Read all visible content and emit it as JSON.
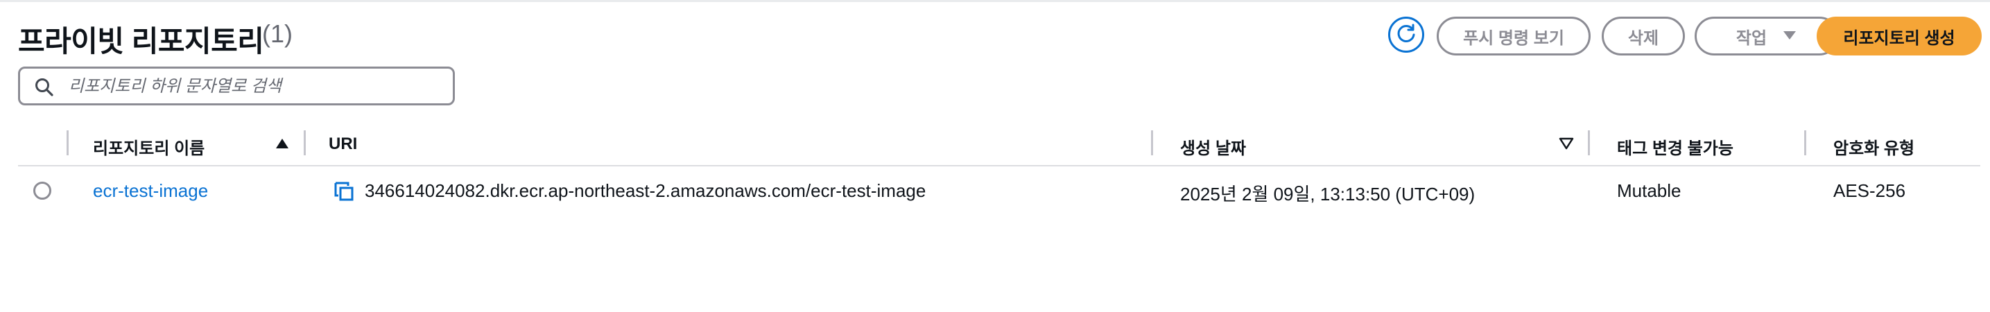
{
  "header": {
    "title": "프라이빗 리포지토리",
    "count": "(1)",
    "push_commands_label": "푸시 명령 보기",
    "delete_label": "삭제",
    "actions_label": "작업",
    "create_label": "리포지토리 생성"
  },
  "search": {
    "placeholder": "리포지토리 하위 문자열로 검색",
    "value": ""
  },
  "table": {
    "columns": [
      "리포지토리 이름",
      "URI",
      "생성 날짜",
      "태그 변경 불가능",
      "암호화 유형"
    ],
    "rows": [
      {
        "name": "ecr-test-image",
        "uri": "346614024082.dkr.ecr.ap-northeast-2.amazonaws.com/ecr-test-image",
        "created": "2025년 2월 09일, 13:13:50 (UTC+09)",
        "tag_immutability": "Mutable",
        "encryption": "AES-256"
      }
    ]
  },
  "icons": {
    "refresh": "refresh-icon",
    "search": "search-icon",
    "caret_down": "caret-down-icon",
    "sort_asc": "sort-ascending-icon",
    "sort_desc": "sort-descending-icon",
    "copy": "copy-icon"
  },
  "colors": {
    "accent": "#0972d3",
    "primary_button": "#f5a537",
    "disabled": "#8c8c94"
  }
}
